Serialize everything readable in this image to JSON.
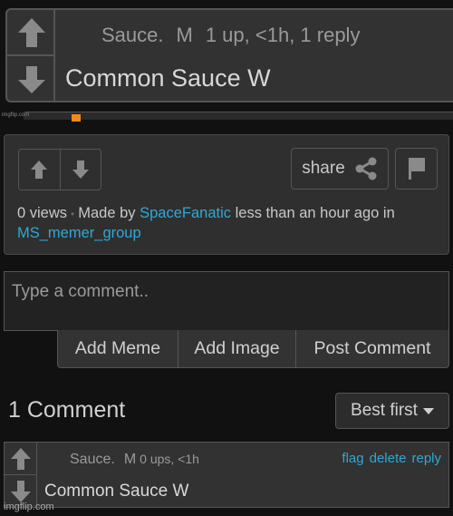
{
  "top_comment": {
    "username": "Sauce.",
    "badge": "M",
    "stats": "1 up, <1h, 1 reply",
    "text": "Common Sauce W",
    "upvote_icon": "arrow-up-icon",
    "downvote_icon": "arrow-down-icon"
  },
  "scrubber": {
    "watermark": "imgflip.com",
    "accent_color": "#f08a18"
  },
  "post_info": {
    "share_label": "share",
    "views": "0 views",
    "made_by_prefix": "Made by",
    "author": "SpaceFanatic",
    "time_text": "less than an hour ago in",
    "stream": "MS_memer_group",
    "link_color": "#2fa8d6"
  },
  "comment_form": {
    "placeholder": "Type a comment..",
    "add_meme_label": "Add Meme",
    "add_image_label": "Add Image",
    "post_comment_label": "Post Comment"
  },
  "comments_header": {
    "count_label": "1 Comment",
    "sort_selected": "Best first"
  },
  "comments": [
    {
      "username": "Sauce.",
      "badge": "M",
      "stats": "0 ups, <1h",
      "actions": [
        "flag",
        "delete",
        "reply"
      ],
      "text": "Common Sauce W"
    }
  ],
  "watermark": "imgflip.com"
}
